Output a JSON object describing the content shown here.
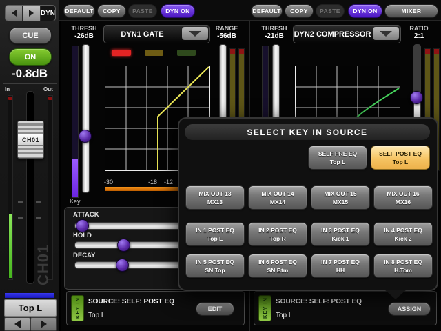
{
  "colors": {
    "accent_purple": "#5c1fd0",
    "selected_source_orange": "#f6c463",
    "key_in_green": "#6fb02a",
    "on_green": "#5fb821",
    "key_meter_orange": "#e87700",
    "gate_curve_yellow": "#e8e455",
    "comp_curve_green": "#46d45c",
    "strip_blue": "#2424e0"
  },
  "channel_strip": {
    "nav_label": "DYN",
    "cue_label": "CUE",
    "on_label": "ON",
    "gain_readout": "-0.8dB",
    "meter_in_label": "In",
    "meter_out_label": "Out",
    "fader_cap_label": "CH01",
    "channel_id_watermark": "CH01",
    "channel_name": "Top L"
  },
  "toolbar": {
    "dyn1": {
      "default_label": "DEFAULT",
      "copy_label": "COPY",
      "paste_label": "PASTE",
      "dyn_on_label": "DYN ON"
    },
    "dyn2": {
      "default_label": "DEFAULT",
      "copy_label": "COPY",
      "paste_label": "PASTE",
      "dyn_on_label": "DYN ON",
      "mixer_label": "MIXER"
    }
  },
  "dyn1": {
    "thresh_label": "THRESH",
    "thresh_value": "-26dB",
    "processor_name": "DYN1 GATE",
    "range_label": "RANGE",
    "range_value": "-56dB",
    "key_meter_label": "Key",
    "meter_scale": [
      "-30",
      "-18",
      "-12"
    ]
  },
  "dyn2": {
    "thresh_label": "THRESH",
    "thresh_value": "-21dB",
    "processor_name": "DYN2 COMPRESSOR",
    "ratio_label": "RATIO",
    "ratio_value": "2:1"
  },
  "envelope": {
    "attack_label": "ATTACK",
    "hold_label": "HOLD",
    "decay_label": "DECAY"
  },
  "key_in_popup": {
    "title": "SELECT KEY IN SOURCE",
    "sources": [
      {
        "label": "SELF PRE EQ",
        "sub": "Top L"
      },
      {
        "label": "SELF POST EQ",
        "sub": "Top L"
      },
      {
        "label": "MIX OUT 13",
        "sub": "MX13"
      },
      {
        "label": "MIX OUT 14",
        "sub": "MX14"
      },
      {
        "label": "MIX OUT 15",
        "sub": "MX15"
      },
      {
        "label": "MIX OUT 16",
        "sub": "MX16"
      },
      {
        "label": "IN 1 POST EQ",
        "sub": "Top L"
      },
      {
        "label": "IN 2 POST EQ",
        "sub": "Top R"
      },
      {
        "label": "IN 3 POST EQ",
        "sub": "Kick 1"
      },
      {
        "label": "IN 4 POST EQ",
        "sub": "Kick 2"
      },
      {
        "label": "IN 5 POST EQ",
        "sub": "SN Top"
      },
      {
        "label": "IN 6 POST EQ",
        "sub": "SN Btm"
      },
      {
        "label": "IN 7 POST EQ",
        "sub": "HH"
      },
      {
        "label": "IN 8 POST EQ",
        "sub": "H.Tom"
      }
    ]
  },
  "key_in_left": {
    "badge": "KEY IN",
    "source_line": "SOURCE:  SELF: POST EQ",
    "source_name": "Top L",
    "button_label": "EDIT"
  },
  "key_in_right": {
    "badge": "KEY IN",
    "source_line": "SOURCE:  SELF: POST EQ",
    "source_name": "Top L",
    "button_label": "ASSIGN"
  }
}
